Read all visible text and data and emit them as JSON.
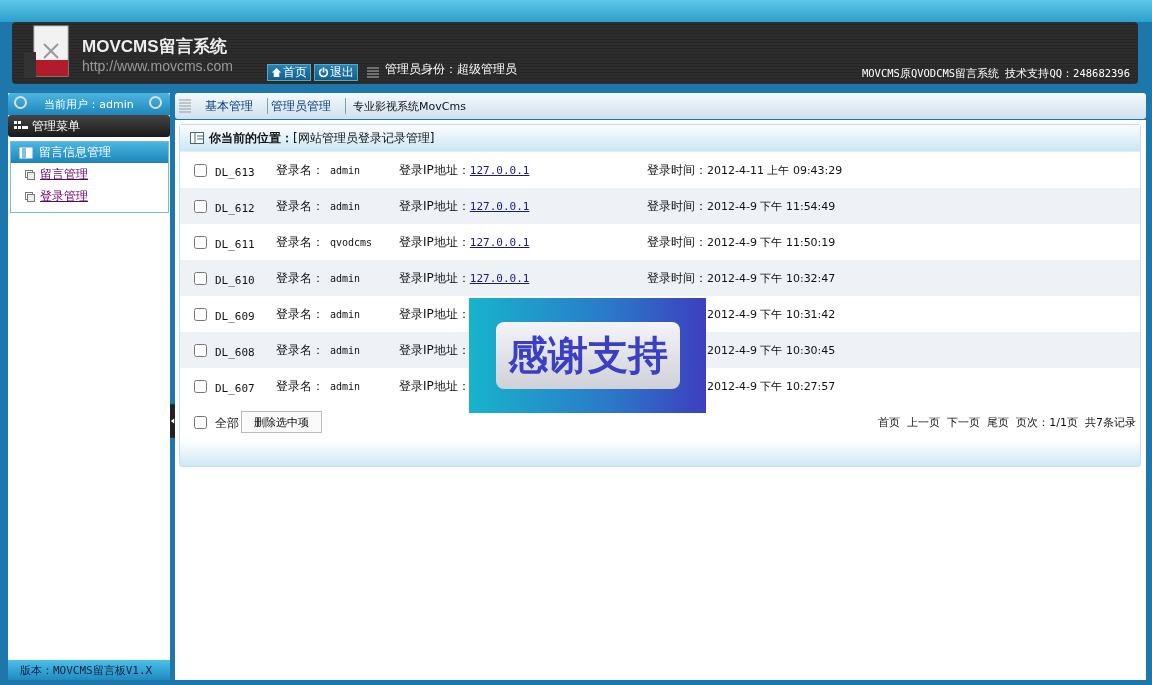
{
  "header": {
    "title": "MOVCMS留言系统",
    "url": "http://www.movcms.com",
    "buttons": [
      {
        "label": "首页"
      },
      {
        "label": "退出"
      }
    ],
    "role": "管理员身份：超级管理员",
    "support": "MOVCMS原QVODCMS留言系统 技术支持QQ：248682396"
  },
  "sidebar": {
    "current_user": "当前用户：admin",
    "menu_title": "管理菜单",
    "groups": [
      {
        "title": "留言信息管理",
        "items": [
          "留言管理",
          "登录管理"
        ]
      }
    ],
    "version": "版本：MOVCMS留言板V1.X"
  },
  "nav": {
    "items": [
      {
        "label": "基本管理",
        "kind": "link"
      },
      {
        "label": "管理员管理",
        "kind": "link"
      },
      {
        "label": "专业影视系统MovCms",
        "kind": "text"
      }
    ]
  },
  "breadcrumb": {
    "label": "你当前的位置：",
    "path": "[网站管理员登录记录管理]"
  },
  "rows": [
    {
      "id": "DL_613",
      "checked": false,
      "name_label": "登录名：",
      "name": "admin",
      "ip_label": "登录IP地址：",
      "ip": "127.0.0.1",
      "time_label": "登录时间：",
      "time": "2012-4-11 上午 09:43:29"
    },
    {
      "id": "DL_612",
      "checked": false,
      "name_label": "登录名：",
      "name": "admin",
      "ip_label": "登录IP地址：",
      "ip": "127.0.0.1",
      "time_label": "登录时间：",
      "time": "2012-4-9 下午 11:54:49"
    },
    {
      "id": "DL_611",
      "checked": false,
      "name_label": "登录名：",
      "name": "qvodcms",
      "ip_label": "登录IP地址：",
      "ip": "127.0.0.1",
      "time_label": "登录时间：",
      "time": "2012-4-9 下午 11:50:19"
    },
    {
      "id": "DL_610",
      "checked": false,
      "name_label": "登录名：",
      "name": "admin",
      "ip_label": "登录IP地址：",
      "ip": "127.0.0.1",
      "time_label": "登录时间：",
      "time": "2012-4-9 下午 10:32:47"
    },
    {
      "id": "DL_609",
      "checked": false,
      "name_label": "登录名：",
      "name": "admin",
      "ip_label": "登录IP地址：",
      "time": "2012-4-9 下午 10:31:42"
    },
    {
      "id": "DL_608",
      "checked": false,
      "name_label": "登录名：",
      "name": "admin",
      "ip_label": "登录IP地址：",
      "time": "2012-4-9 下午 10:30:45"
    },
    {
      "id": "DL_607",
      "checked": false,
      "name_label": "登录名：",
      "name": "admin",
      "ip_label": "登录IP地址：",
      "time": "2012-4-9 下午 10:27:57"
    }
  ],
  "footer": {
    "select_all": {
      "label": "全部",
      "checked": false
    },
    "delete_button": "删除选中项",
    "pager": [
      "首页",
      "上一页",
      "下一页",
      "尾页",
      "页次：1/1页",
      "共7条记录"
    ]
  },
  "overlay": {
    "text": "感谢支持"
  }
}
